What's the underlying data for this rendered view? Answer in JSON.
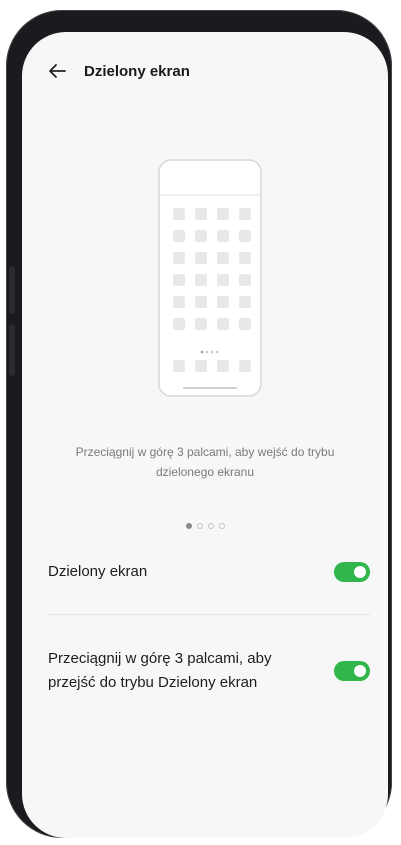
{
  "header": {
    "back_icon": "arrow-left-icon",
    "title": "Dzielony ekran"
  },
  "illustration": {
    "icon": "phone-home-screen-illustration"
  },
  "hint": {
    "line1": "Przeciągnij w górę 3 palcami, aby wejść do trybu",
    "line2": "dzielonego ekranu"
  },
  "pager": {
    "count": 4,
    "active_index": 0
  },
  "settings": [
    {
      "label": "Dzielony ekran",
      "enabled": true
    },
    {
      "label": "Przeciągnij w górę 3 palcami, aby przejść do trybu Dzielony ekran",
      "enabled": true
    }
  ],
  "colors": {
    "toggle_on": "#31b64b",
    "screen_bg": "#f7f7f8",
    "frame": "#1a1b1f"
  }
}
